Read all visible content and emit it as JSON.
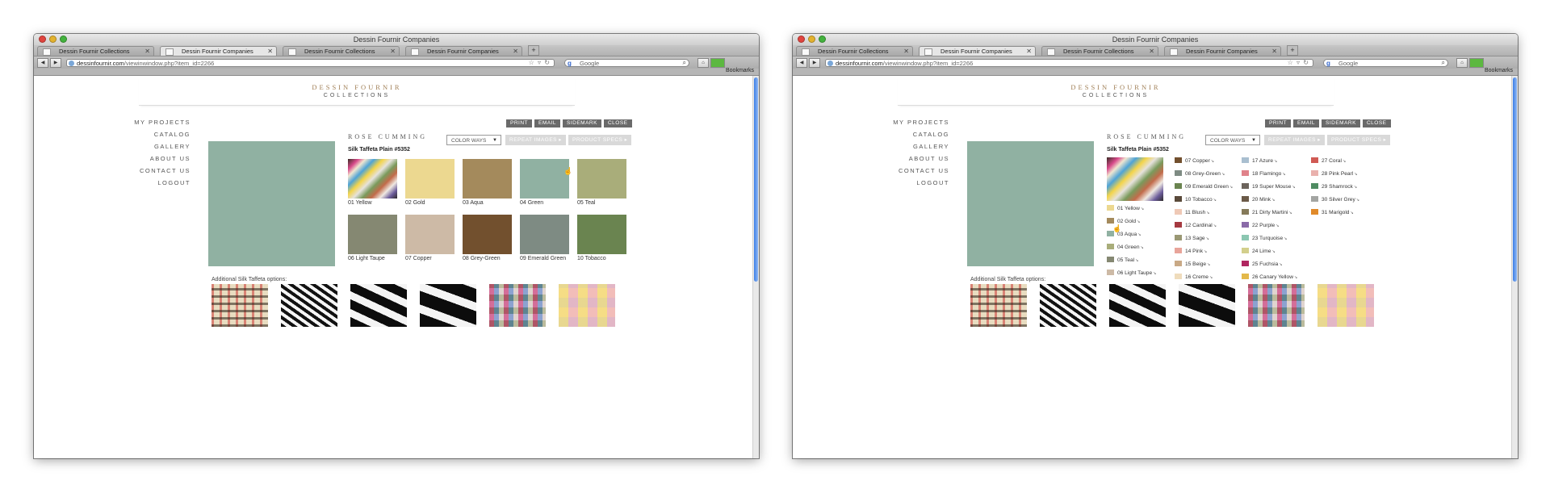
{
  "windows": [
    {
      "id": "left",
      "window_title": "Dessin Fournir Companies",
      "tabs": [
        {
          "label": "Dessin Fournir Collections",
          "active": false
        },
        {
          "label": "Dessin Fournir Companies",
          "active": true
        },
        {
          "label": "Dessin Fournir Collections",
          "active": false
        },
        {
          "label": "Dessin Fournir Companies",
          "active": false
        }
      ],
      "url_domain": "dessinfournir.com",
      "url_path": "/viewinwindow.php?item_id=2266",
      "search_placeholder": "Google",
      "bookmarks_label": "Bookmarks"
    },
    {
      "id": "right",
      "window_title": "Dessin Fournir Companies",
      "tabs": [
        {
          "label": "Dessin Fournir Collections",
          "active": false
        },
        {
          "label": "Dessin Fournir Companies",
          "active": true
        },
        {
          "label": "Dessin Fournir Collections",
          "active": false
        },
        {
          "label": "Dessin Fournir Companies",
          "active": false
        }
      ],
      "url_domain": "dessinfournir.com",
      "url_path": "/viewinwindow.php?item_id=2266",
      "search_placeholder": "Google",
      "bookmarks_label": "Bookmarks"
    }
  ],
  "site": {
    "brand_line1": "DESSIN FOURNIR",
    "brand_line2": "COLLECTIONS",
    "nav": [
      "MY PROJECTS",
      "CATALOG",
      "GALLERY",
      "ABOUT US",
      "CONTACT US",
      "LOGOUT"
    ],
    "actions": [
      "PRINT",
      "EMAIL",
      "SIDEMARK",
      "CLOSE"
    ],
    "collection": "ROSE CUMMING",
    "product": "Silk Taffeta Plain #5352",
    "color_ways_label": "COLOR WAYS",
    "repeat_images_label": "REPEAT IMAGES",
    "product_specs_label": "PRODUCT SPECS",
    "selected_color_hex": "#90b1a2",
    "additional_label": "Additional Silk Taffeta options:",
    "additional_textures": [
      "plaid",
      "zigzag-stripe",
      "bw-wave",
      "bw-bold-wave",
      "multicolor-stripe",
      "pastel-check"
    ]
  },
  "swatches_grid": [
    {
      "label": "01 Yellow",
      "color": "rainbow"
    },
    {
      "label": "02 Gold",
      "color": "#ecd890"
    },
    {
      "label": "03 Aqua",
      "color": "#a48a5c"
    },
    {
      "label": "04 Green",
      "color": "#90b1a2"
    },
    {
      "label": "05 Teal",
      "color": "#a9ad7a"
    },
    {
      "label": "06 Light Taupe",
      "color": "#858872"
    },
    {
      "label": "07 Copper",
      "color": "#cdbaa6"
    },
    {
      "label": "08 Grey-Green",
      "color": "#72502e"
    },
    {
      "label": "09 Emerald Green",
      "color": "#7e8b83"
    },
    {
      "label": "10 Tobacco",
      "color": "#6a8450"
    }
  ],
  "color_ways_list": [
    {
      "label": "01 Yellow",
      "color": "#ecd890"
    },
    {
      "label": "02 Gold",
      "color": "#a48a5c"
    },
    {
      "label": "03 Aqua",
      "color": "#90b1a2"
    },
    {
      "label": "04 Green",
      "color": "#a9ad7a"
    },
    {
      "label": "05 Teal",
      "color": "#858872"
    },
    {
      "label": "06 Light Taupe",
      "color": "#cdbaa6"
    },
    {
      "label": "07 Copper",
      "color": "#72502e"
    },
    {
      "label": "08 Grey-Green",
      "color": "#7e8b83"
    },
    {
      "label": "09 Emerald Green",
      "color": "#6a8450"
    },
    {
      "label": "10 Tobacco",
      "color": "#5a4a3a"
    },
    {
      "label": "11 Blush",
      "color": "#efc9b6"
    },
    {
      "label": "12 Cardinal",
      "color": "#a53a40"
    },
    {
      "label": "13 Sage",
      "color": "#9a9874"
    },
    {
      "label": "14 Pink",
      "color": "#e8a49a"
    },
    {
      "label": "15 Beige",
      "color": "#c9a986"
    },
    {
      "label": "16 Creme",
      "color": "#efdcbc"
    },
    {
      "label": "17 Azure",
      "color": "#a9bfd0"
    },
    {
      "label": "18 Flamingo",
      "color": "#e0828a"
    },
    {
      "label": "19 Super Mouse",
      "color": "#6c645c"
    },
    {
      "label": "20 Mink",
      "color": "#6b5a48"
    },
    {
      "label": "21 Dirty Martini",
      "color": "#857a5a"
    },
    {
      "label": "22 Purple",
      "color": "#8a6aa8"
    },
    {
      "label": "23 Turquoise",
      "color": "#8cc7b2"
    },
    {
      "label": "24 Lime",
      "color": "#d3cf8c"
    },
    {
      "label": "25 Fuchsia",
      "color": "#b02660"
    },
    {
      "label": "26 Canary Yellow",
      "color": "#e3b84a"
    },
    {
      "label": "27 Coral",
      "color": "#d05a54"
    },
    {
      "label": "28 Pink Pearl",
      "color": "#e9b1ad"
    },
    {
      "label": "29 Shamrock",
      "color": "#4f8c62"
    },
    {
      "label": "30 Silver Grey",
      "color": "#a3a5a2"
    },
    {
      "label": "31 Marigold",
      "color": "#e08a2a"
    }
  ]
}
